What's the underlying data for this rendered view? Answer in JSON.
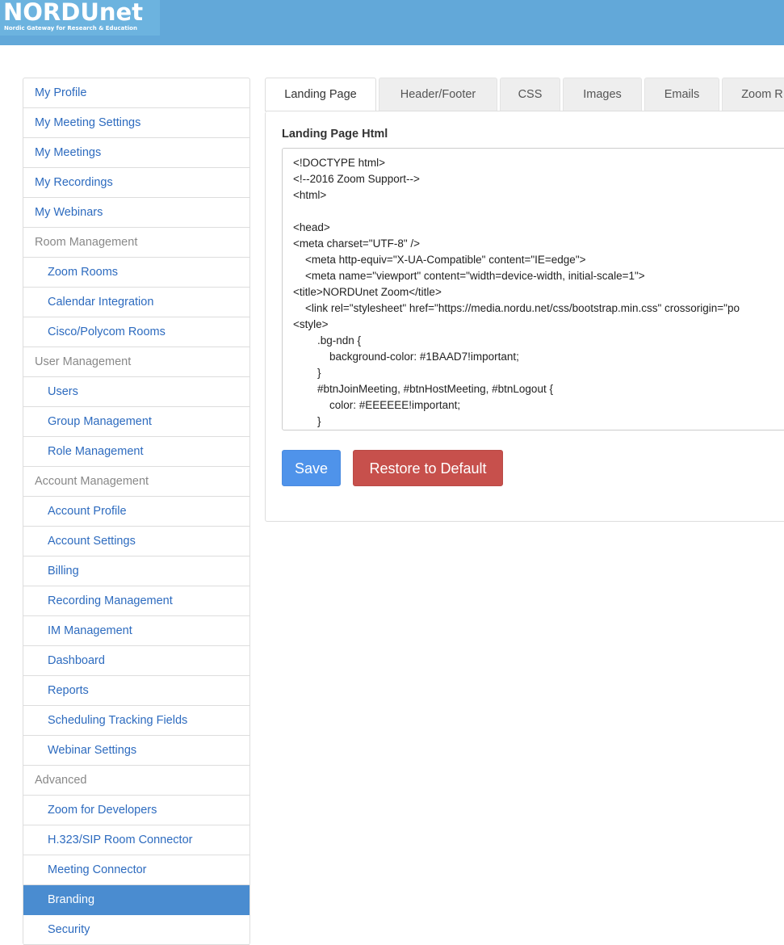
{
  "header": {
    "logo_text": "NORDUnet",
    "logo_tagline": "Nordic Gateway for Research & Education",
    "bar_color": "#62a8d9"
  },
  "sidebar": {
    "items": [
      {
        "label": "My Profile",
        "type": "link"
      },
      {
        "label": "My Meeting Settings",
        "type": "link"
      },
      {
        "label": "My Meetings",
        "type": "link"
      },
      {
        "label": "My Recordings",
        "type": "link"
      },
      {
        "label": "My Webinars",
        "type": "link"
      },
      {
        "label": "Room Management",
        "type": "section"
      },
      {
        "label": "Zoom Rooms",
        "type": "sub"
      },
      {
        "label": "Calendar Integration",
        "type": "sub"
      },
      {
        "label": "Cisco/Polycom Rooms",
        "type": "sub"
      },
      {
        "label": "User Management",
        "type": "section"
      },
      {
        "label": "Users",
        "type": "sub"
      },
      {
        "label": "Group Management",
        "type": "sub"
      },
      {
        "label": "Role Management",
        "type": "sub"
      },
      {
        "label": "Account Management",
        "type": "section"
      },
      {
        "label": "Account Profile",
        "type": "sub"
      },
      {
        "label": "Account Settings",
        "type": "sub"
      },
      {
        "label": "Billing",
        "type": "sub"
      },
      {
        "label": "Recording Management",
        "type": "sub"
      },
      {
        "label": "IM Management",
        "type": "sub"
      },
      {
        "label": "Dashboard",
        "type": "sub"
      },
      {
        "label": "Reports",
        "type": "sub"
      },
      {
        "label": "Scheduling Tracking Fields",
        "type": "sub"
      },
      {
        "label": "Webinar Settings",
        "type": "sub"
      },
      {
        "label": "Advanced",
        "type": "section"
      },
      {
        "label": "Zoom for Developers",
        "type": "sub"
      },
      {
        "label": "H.323/SIP Room Connector",
        "type": "sub"
      },
      {
        "label": "Meeting Connector",
        "type": "sub"
      },
      {
        "label": "Branding",
        "type": "sub",
        "active": true
      },
      {
        "label": "Security",
        "type": "sub"
      }
    ],
    "active_color": "#4a8cd0"
  },
  "tabs": [
    {
      "label": "Landing Page",
      "active": true
    },
    {
      "label": "Header/Footer"
    },
    {
      "label": "CSS"
    },
    {
      "label": "Images"
    },
    {
      "label": "Emails"
    },
    {
      "label": "Zoom R"
    }
  ],
  "editor": {
    "label": "Landing Page Html",
    "lines": [
      "<!DOCTYPE html>",
      "<!--2016 Zoom Support-->",
      "<html>",
      "",
      "<head>",
      "<meta charset=\"UTF-8\" />",
      "    <meta http-equiv=\"X-UA-Compatible\" content=\"IE=edge\">",
      "    <meta name=\"viewport\" content=\"width=device-width, initial-scale=1\">",
      "<title>NORDUnet Zoom</title>",
      "    <link rel=\"stylesheet\" href=\"https://media.nordu.net/css/bootstrap.min.css\" crossorigin=\"po",
      "<style>",
      "        .bg-ndn {",
      "            background-color: #1BAAD7!important;",
      "        }",
      "        #btnJoinMeeting, #btnHostMeeting, #btnLogout {",
      "            color: #EEEEEE!important;",
      "        }"
    ]
  },
  "buttons": {
    "save_label": "Save",
    "restore_label": "Restore to Default",
    "save_color": "#4f93ea",
    "restore_color": "#c7504c"
  }
}
